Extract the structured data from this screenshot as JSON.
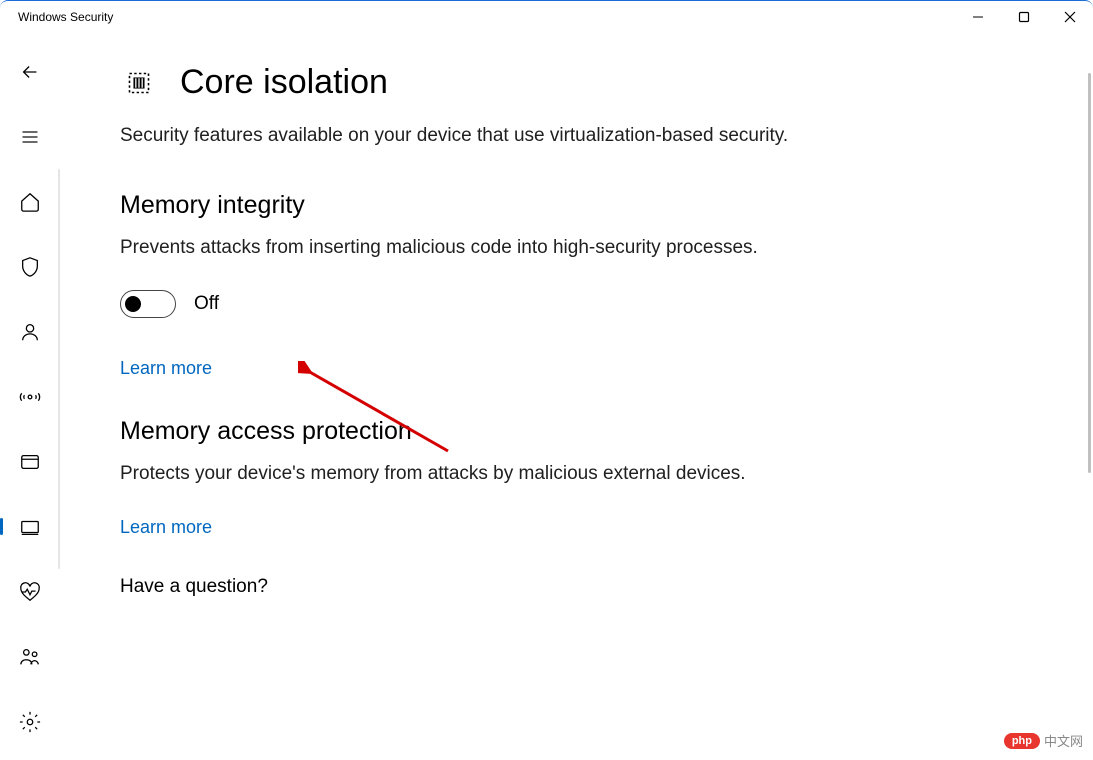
{
  "window": {
    "title": "Windows Security"
  },
  "page": {
    "title": "Core isolation",
    "subtitle": "Security features available on your device that use virtualization-based security."
  },
  "sections": {
    "memory_integrity": {
      "title": "Memory integrity",
      "desc": "Prevents attacks from inserting malicious code into high-security processes.",
      "toggle_state": "Off",
      "learn_more": "Learn more"
    },
    "memory_access": {
      "title": "Memory access protection",
      "desc": "Protects your device's memory from attacks by malicious external devices.",
      "learn_more": "Learn more"
    }
  },
  "footer": {
    "question": "Have a question?"
  },
  "watermark": {
    "badge": "php",
    "text": "中文网"
  }
}
